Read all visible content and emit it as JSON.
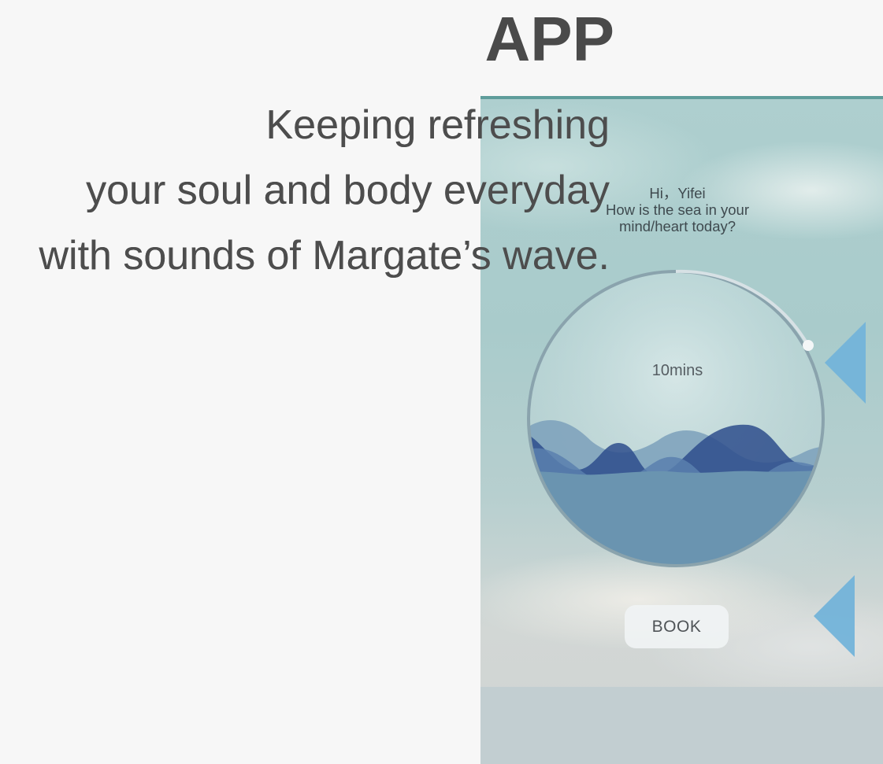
{
  "header": {
    "title": "APP"
  },
  "tagline": {
    "lines": [
      "Keeping refreshing",
      "your soul and body everyday",
      "with sounds of Margate’s wave."
    ]
  },
  "phone": {
    "greeting": {
      "name_line": "Hi，Yifei",
      "question_line1": "How is the sea in your",
      "question_line2": "mind/heart today?"
    },
    "timer": {
      "label": "10mins"
    },
    "book_button": {
      "label": "BOOK"
    },
    "icons": {
      "upper": "triangle-left-icon",
      "lower": "triangle-left-icon"
    },
    "colors": {
      "wave_dark": "#2e4d8c",
      "wave_mid": "#4f73a6",
      "wave_light": "#7fa3bd",
      "water": "#6a94b0",
      "triangle": "#73b3d9"
    }
  }
}
